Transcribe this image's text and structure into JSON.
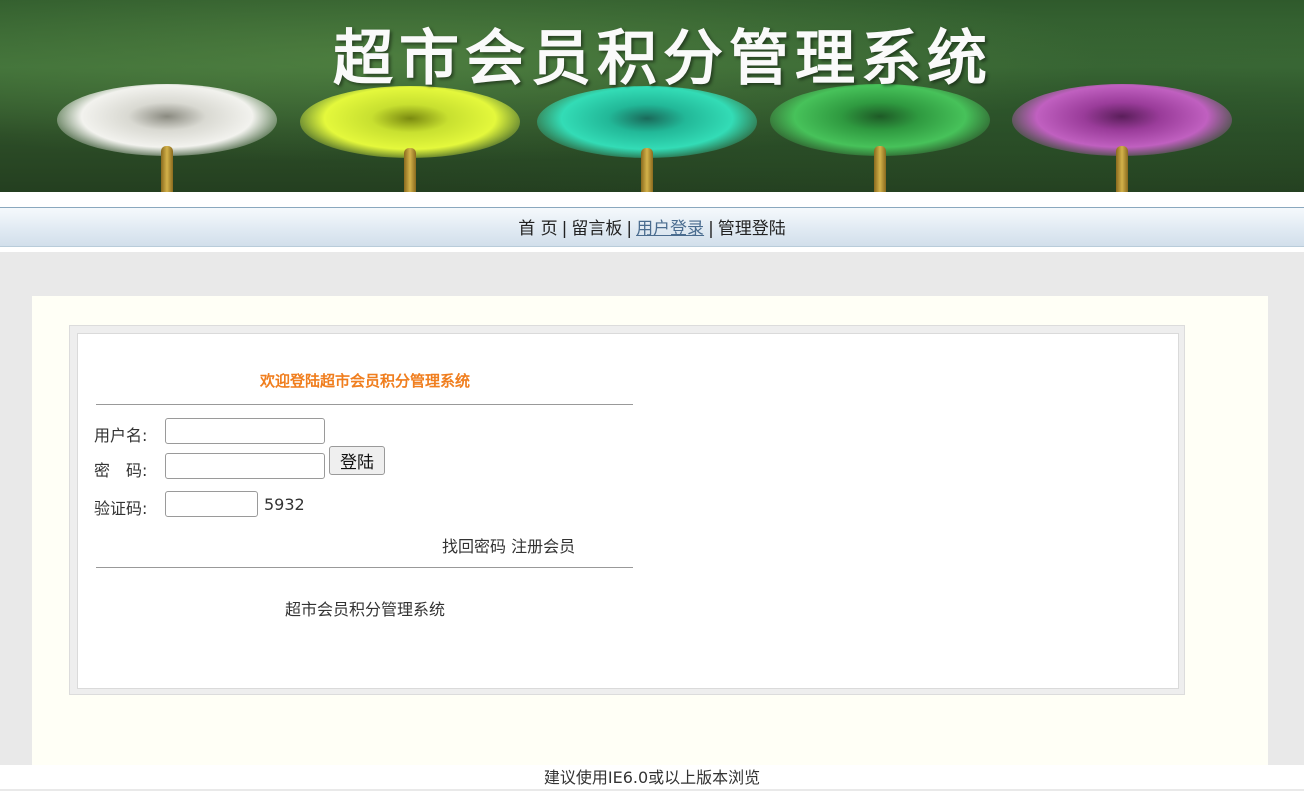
{
  "banner": {
    "title": "超市会员积分管理系统",
    "flower_colors": [
      "#e9e9e9",
      "#d8f03a",
      "#2fd3b0",
      "#3fb24e",
      "#b14fb0"
    ]
  },
  "nav": {
    "items": [
      {
        "label": "首 页",
        "active": false
      },
      {
        "label": "留言板",
        "active": false
      },
      {
        "label": "用户登录",
        "active": true
      },
      {
        "label": "管理登陆",
        "active": false
      }
    ],
    "separator": "|"
  },
  "login": {
    "welcome": "欢迎登陆超市会员积分管理系统",
    "username_label": "用户名:",
    "username_value": "",
    "password_label": "密　码:",
    "password_value": "",
    "captcha_label": "验证码:",
    "captcha_value": "",
    "captcha_code": "5932",
    "login_button": "登陆",
    "forgot_link": "找回密码",
    "register_link": "注册会员",
    "footer_text": "超市会员积分管理系统"
  },
  "footer": {
    "text": "建议使用IE6.0或以上版本浏览"
  },
  "colors": {
    "accent": "#f07e1e",
    "active_link": "#4a6c8f",
    "content_bg": "#fffff6",
    "page_bg": "#e9e9e9"
  }
}
